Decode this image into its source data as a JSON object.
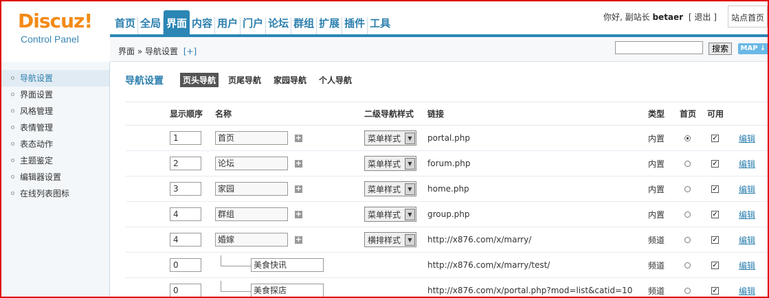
{
  "logo": {
    "main": "Discuz!",
    "sub": "Control Panel"
  },
  "topnav": [
    {
      "label": "首页",
      "active": false
    },
    {
      "label": "全局",
      "active": false
    },
    {
      "label": "界面",
      "active": true
    },
    {
      "label": "内容",
      "active": false
    },
    {
      "label": "用户",
      "active": false
    },
    {
      "label": "门户",
      "active": false
    },
    {
      "label": "论坛",
      "active": false
    },
    {
      "label": "群组",
      "active": false
    },
    {
      "label": "扩展",
      "active": false
    },
    {
      "label": "插件",
      "active": false
    },
    {
      "label": "工具",
      "active": false
    }
  ],
  "user": {
    "greeting": "你好, 副站长",
    "name": "betaer",
    "logout": "[ 退出 ]",
    "home_button": "站点首页"
  },
  "breadcrumb": {
    "path": "界面 » 导航设置",
    "add": "[+]"
  },
  "search": {
    "button": "搜索",
    "value": ""
  },
  "map_button": "MAP ↓",
  "sidebar": [
    {
      "label": "导航设置",
      "active": true
    },
    {
      "label": "界面设置",
      "active": false
    },
    {
      "label": "风格管理",
      "active": false
    },
    {
      "label": "表情管理",
      "active": false
    },
    {
      "label": "表态动作",
      "active": false
    },
    {
      "label": "主题鉴定",
      "active": false
    },
    {
      "label": "编辑器设置",
      "active": false
    },
    {
      "label": "在线列表图标",
      "active": false
    }
  ],
  "main": {
    "title": "导航设置",
    "tabs": [
      {
        "label": "页头导航",
        "active": true
      },
      {
        "label": "页尾导航",
        "active": false
      },
      {
        "label": "家园导航",
        "active": false
      },
      {
        "label": "个人导航",
        "active": false
      }
    ],
    "columns": {
      "order": "显示顺序",
      "name": "名称",
      "substyle": "二级导航样式",
      "link": "链接",
      "type": "类型",
      "home": "首页",
      "enabled": "可用"
    },
    "rows": [
      {
        "order": "1",
        "name": "首页",
        "child": false,
        "substyle": "菜单样式",
        "link": "portal.php",
        "type": "内置",
        "home": true,
        "enabled": true,
        "edit": "编辑"
      },
      {
        "order": "2",
        "name": "论坛",
        "child": false,
        "substyle": "菜单样式",
        "link": "forum.php",
        "type": "内置",
        "home": false,
        "enabled": true,
        "edit": "编辑"
      },
      {
        "order": "3",
        "name": "家园",
        "child": false,
        "substyle": "菜单样式",
        "link": "home.php",
        "type": "内置",
        "home": false,
        "enabled": true,
        "edit": "编辑"
      },
      {
        "order": "4",
        "name": "群组",
        "child": false,
        "substyle": "菜单样式",
        "link": "group.php",
        "type": "内置",
        "home": false,
        "enabled": true,
        "edit": "编辑"
      },
      {
        "order": "4",
        "name": "婚嫁",
        "child": false,
        "substyle": "横排样式",
        "link": "http://x876.com/x/marry/",
        "type": "频道",
        "home": false,
        "enabled": true,
        "edit": "编辑"
      },
      {
        "order": "0",
        "name": "美食快讯",
        "child": true,
        "substyle": "",
        "link": "http://x876.com/x/marry/test/",
        "type": "频道",
        "home": false,
        "enabled": true,
        "edit": "编辑"
      },
      {
        "order": "0",
        "name": "美食探店",
        "child": true,
        "substyle": "",
        "link": "http://x876.com/x/portal.php?mod=list&catid=10",
        "type": "频道",
        "home": false,
        "enabled": true,
        "edit": "编辑"
      }
    ]
  }
}
